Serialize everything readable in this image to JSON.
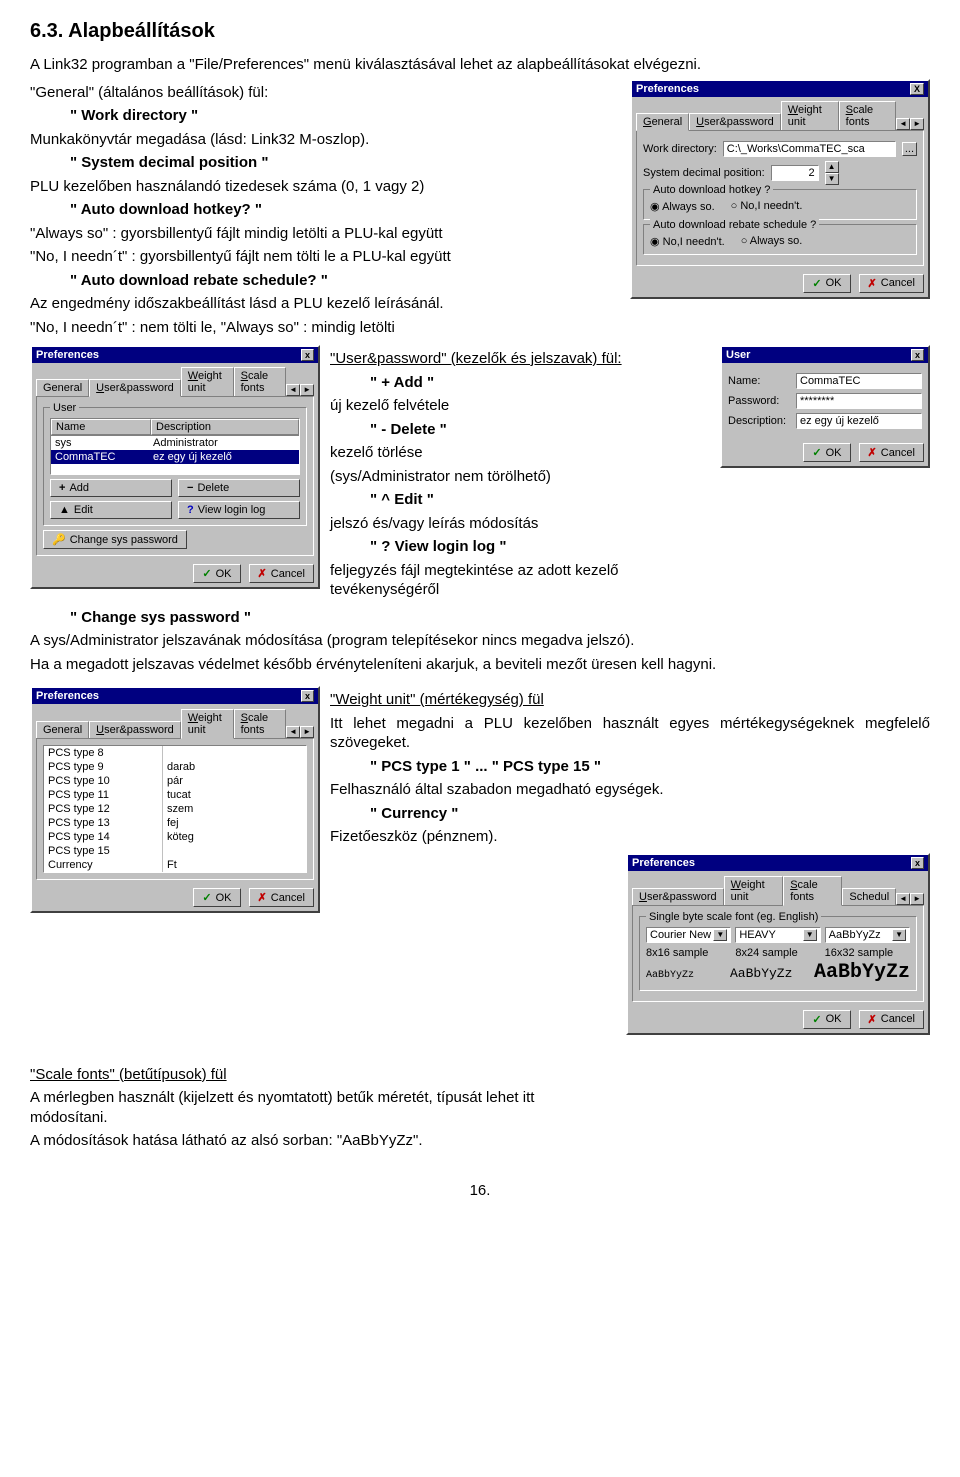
{
  "heading": "6.3. Alapbeállítások",
  "intro": "A Link32 programban a \"File/Preferences\" menü kiválasztásával lehet az alapbeállításokat elvégezni.",
  "general_ful": "\"General\" (általános beállítások) fül:",
  "work_dir_title": "\" Work directory \"",
  "work_dir_text": "Munkakönyvtár megadása (lásd: Link32 M-oszlop).",
  "sysdec_title": "\" System decimal position \"",
  "sysdec_text": "PLU kezelőben használandó tizedesek száma (0, 1 vagy 2)",
  "autodl_title": "\" Auto download hotkey? \"",
  "autodl_l1": "\"Always so\" : gyorsbillentyű fájlt mindig letölti a PLU-kal együtt",
  "autodl_l2": "\"No, I needn´t\" : gyorsbillentyű fájlt nem tölti le a PLU-kal együtt",
  "rebate_title": "\" Auto download rebate schedule? \"",
  "rebate_l1": "Az engedmény időszakbeállítást lásd a PLU kezelő leírásánál.",
  "rebate_l2": "\"No, I needn´t\" : nem tölti le,   \"Always so\" :  mindig letölti",
  "userpw_ful": "\"User&password\" (kezelők és jelszavak) fül:",
  "add_title": "\" + Add \"",
  "add_text": "új kezelő felvétele",
  "del_title": "\" - Delete \"",
  "del_text1": "kezelő törlése",
  "del_text2": "(sys/Administrator nem törölhető)",
  "edit_title": "\" ^ Edit \"",
  "edit_text": "jelszó és/vagy leírás módosítás",
  "viewlog_title": "\" ? View login log \"",
  "viewlog_text": "feljegyzés fájl megtekintése az adott kezelő tevékenységéről",
  "changepw_title": "\" Change sys password \"",
  "changepw_l1": "A sys/Administrator jelszavának módosítása (program telepítésekor nincs megadva jelszó).",
  "changepw_l2": "Ha a megadott jelszavas védelmet később érvényteleníteni akarjuk, a beviteli mezőt üresen kell hagyni.",
  "wu_title": "\"Weight unit\" (mértékegység) fül",
  "wu_l1": "Itt lehet megadni a PLU kezelőben használt egyes mértékegységeknek megfelelő szövegeket.",
  "wu_pcs_title": "\" PCS type 1 \" ... \" PCS type 15 \"",
  "wu_pcs_text": "Felhasználó által szabadon megadható egységek.",
  "wu_curr_title": "\" Currency \"",
  "wu_curr_text": "Fizetőeszköz (pénznem).",
  "sf_title": "\"Scale fonts\" (betűtípusok) fül",
  "sf_l1": "A mérlegben használt (kijelzett és nyomtatott) betűk méretét, típusát lehet itt módosítani.",
  "sf_l2": "A módosítások hatása látható az alsó sorban: \"AaBbYyZz\".",
  "page": "16.",
  "win": {
    "title": "Preferences",
    "user_title": "User",
    "tab_general": "General",
    "tab_userpw_u": "User&password",
    "tab_wu_u": "Weight unit",
    "tab_sf_u": "Scale fonts",
    "tab_sched": "Schedule",
    "lbl_workdir": "Work directory:",
    "val_workdir": "C:\\_Works\\CommaTEC_sca",
    "lbl_sysdec": "System decimal position:",
    "val_sysdec": "2",
    "grp_autodl": "Auto download hotkey ?",
    "opt_always": "Always so.",
    "opt_no": "No,I needn't.",
    "grp_rebate": "Auto download rebate schedule ?",
    "btn_ok": "OK",
    "btn_cancel": "Cancel",
    "list_name": "Name",
    "list_desc": "Description",
    "row1_name": "sys",
    "row1_desc": "Administrator",
    "row2_name": "CommaTEC",
    "row2_desc": "ez egy új kezelő",
    "btn_add": "Add",
    "btn_delete": "Delete",
    "btn_edit": "Edit",
    "btn_viewlog": "View login log",
    "btn_changesys": "Change sys password",
    "u_name": "Name:",
    "u_pw": "Password:",
    "u_desc": "Description:",
    "u_name_v": "CommaTEC",
    "u_pw_v": "********",
    "u_desc_v": "ez egy új kezelő",
    "pcs8": "PCS type 8",
    "pcs9": "PCS type 9",
    "pcs9_v": "darab",
    "pcs10": "PCS type 10",
    "pcs10_v": "pár",
    "pcs11": "PCS type 11",
    "pcs11_v": "tucat",
    "pcs12": "PCS type 12",
    "pcs12_v": "szem",
    "pcs13": "PCS type 13",
    "pcs13_v": "fej",
    "pcs14": "PCS type 14",
    "pcs14_v": "köteg",
    "pcs15": "PCS type 15",
    "currency": "Currency",
    "currency_v": "Ft",
    "sf_group": "Single byte scale font (eg. English)",
    "sf_combo1": "Courier New",
    "sf_combo2": "HEAVY",
    "sf_combo3": "AaBbYyZz",
    "sf_s8": "8x16 sample",
    "sf_s824": "8x24 sample",
    "sf_s16": "16x32 sample",
    "sf_sample": "AaBbYyZz"
  }
}
